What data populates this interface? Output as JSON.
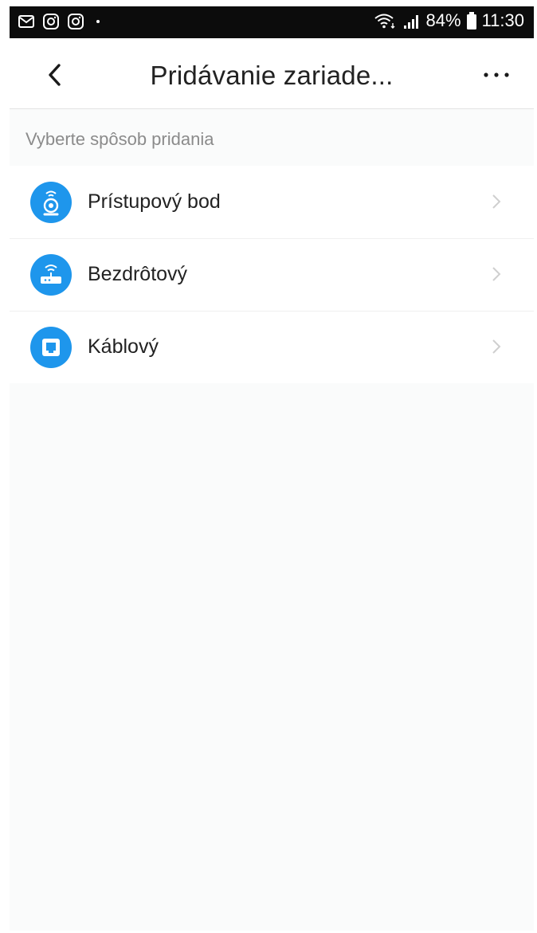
{
  "status_bar": {
    "left_icons": [
      "gmail-icon",
      "instagram-icon",
      "instagram-icon",
      "notification-dot"
    ],
    "battery_percent": "84%",
    "time": "11:30"
  },
  "nav": {
    "title": "Pridávanie zariade...",
    "back_icon": "chevron-left-icon",
    "more_icon": "more-horizontal-icon"
  },
  "section_label": "Vyberte spôsob pridania",
  "options": [
    {
      "label": "Prístupový bod",
      "icon": "camera-wifi-icon"
    },
    {
      "label": "Bezdrôtový",
      "icon": "router-wifi-icon"
    },
    {
      "label": "Káblový",
      "icon": "ethernet-port-icon"
    }
  ],
  "colors": {
    "accent": "#1e96ec",
    "statusbar": "#0c0c0c",
    "background": "#fafbfb"
  }
}
